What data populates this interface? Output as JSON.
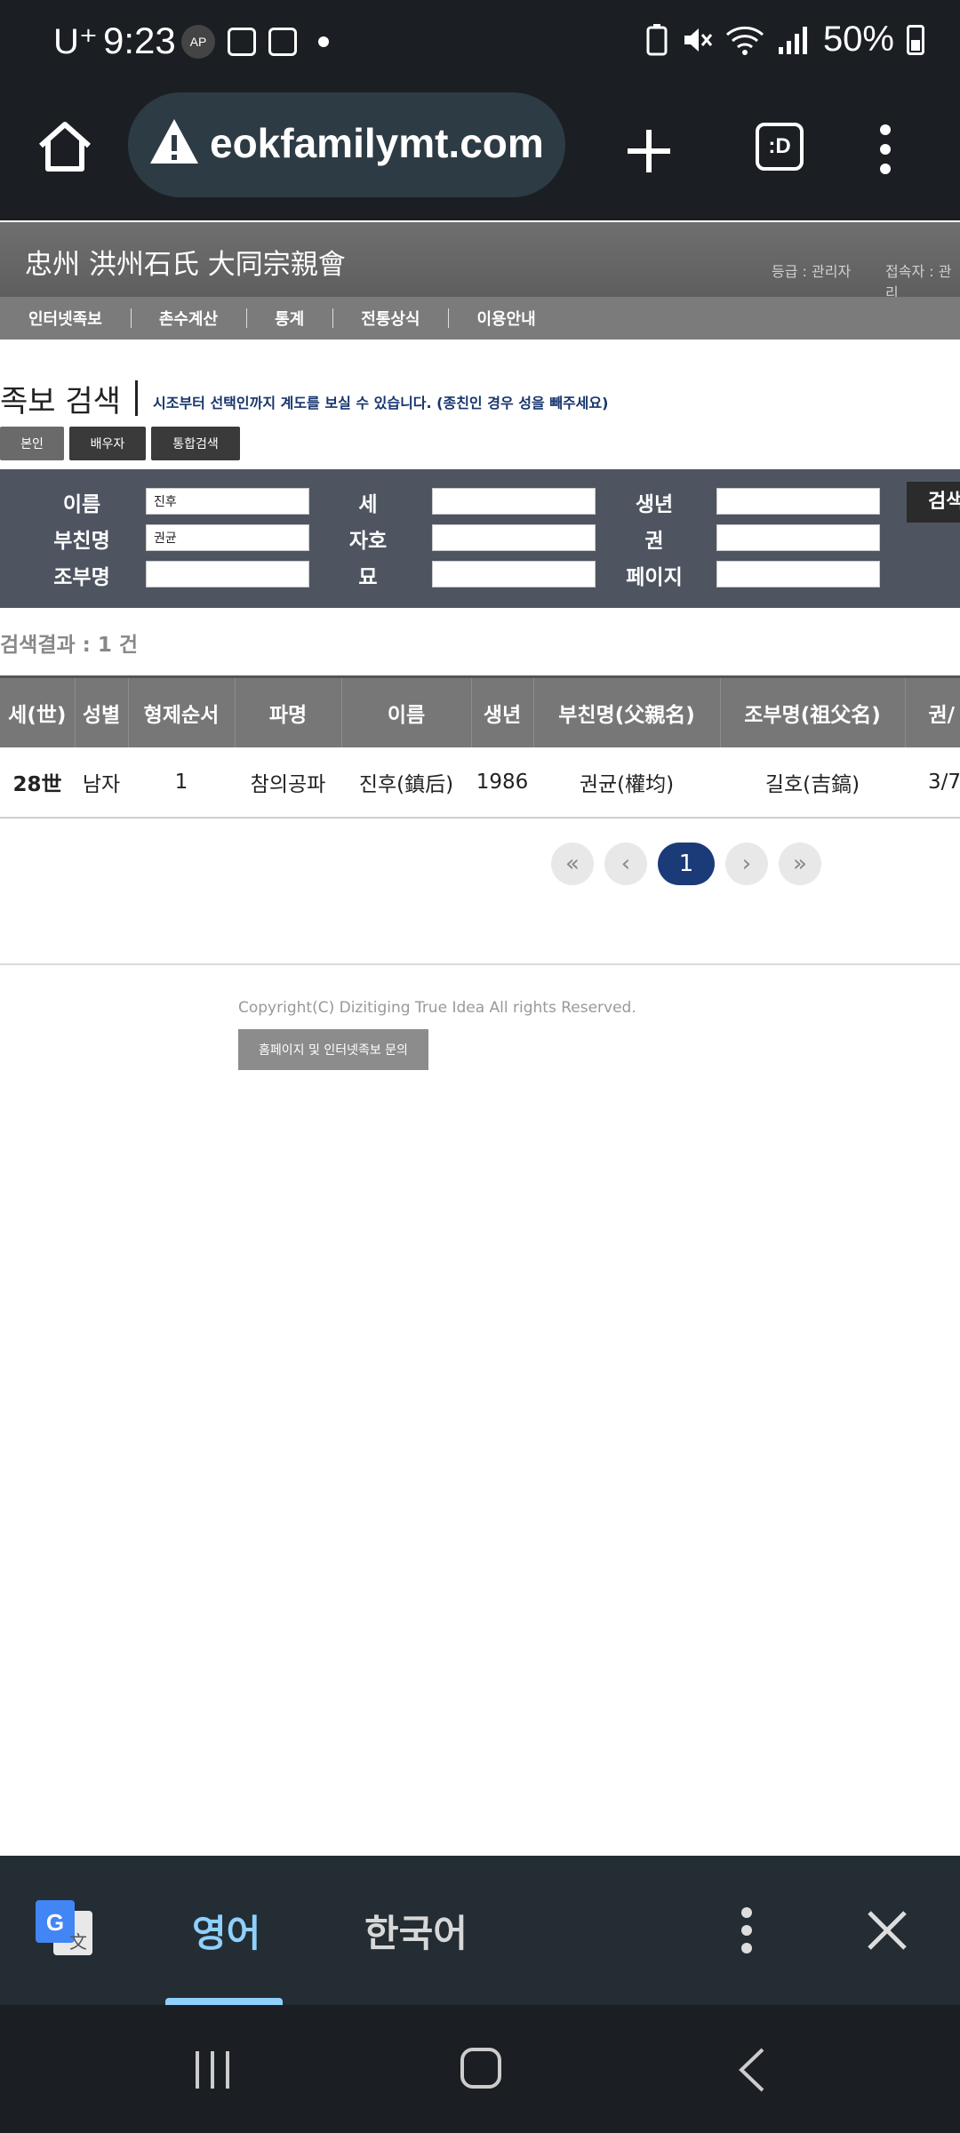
{
  "status_bar": {
    "carrier": "U⁺",
    "time": "9:23",
    "badge": "AP",
    "battery": "50%"
  },
  "browser": {
    "url": "eokfamilymt.com",
    "tabs_label": ":D"
  },
  "site": {
    "title": "忠州 洪州石氏 大同宗親會",
    "grade": "등급 : 관리자",
    "visitor": "접속자 : 관리",
    "nav": [
      "인터넷족보",
      "촌수계산",
      "통계",
      "전통상식",
      "이용안내"
    ]
  },
  "search": {
    "title": "족보 검색",
    "description": "시조부터 선택인까지 계도를 보실 수 있습니다. (종친인 경우 성을 빼주세요)",
    "tabs": [
      "본인",
      "배우자",
      "통합검색"
    ],
    "labels": {
      "name": "이름",
      "father": "부친명",
      "grandfather": "조부명",
      "generation": "세",
      "alias": "자호",
      "grave": "묘",
      "birth": "생년",
      "volume": "권",
      "page": "페이지"
    },
    "values": {
      "name": "진후",
      "father": "권균"
    },
    "button": "검색"
  },
  "results": {
    "count_text": "검색결과 : 1 건",
    "headers": [
      "세(世)",
      "성별",
      "형제순서",
      "파명",
      "이름",
      "생년",
      "부친명(父親名)",
      "조부명(祖父名)",
      "권/"
    ],
    "rows": [
      [
        "28世",
        "남자",
        "1",
        "참의공파",
        "진후(鎮后)",
        "1986",
        "권균(權均)",
        "길호(吉鎬)",
        "3/7"
      ]
    ]
  },
  "pagination": {
    "first": "«",
    "prev": "‹",
    "current": "1",
    "next": "›",
    "last": "»"
  },
  "footer": {
    "copyright": "Copyright(C) Dizitiging True Idea All rights Reserved.",
    "contact": "홈페이지 및 인터넷족보 문의"
  },
  "translate_bar": {
    "lang_active": "영어",
    "lang_inactive": "한국어"
  }
}
